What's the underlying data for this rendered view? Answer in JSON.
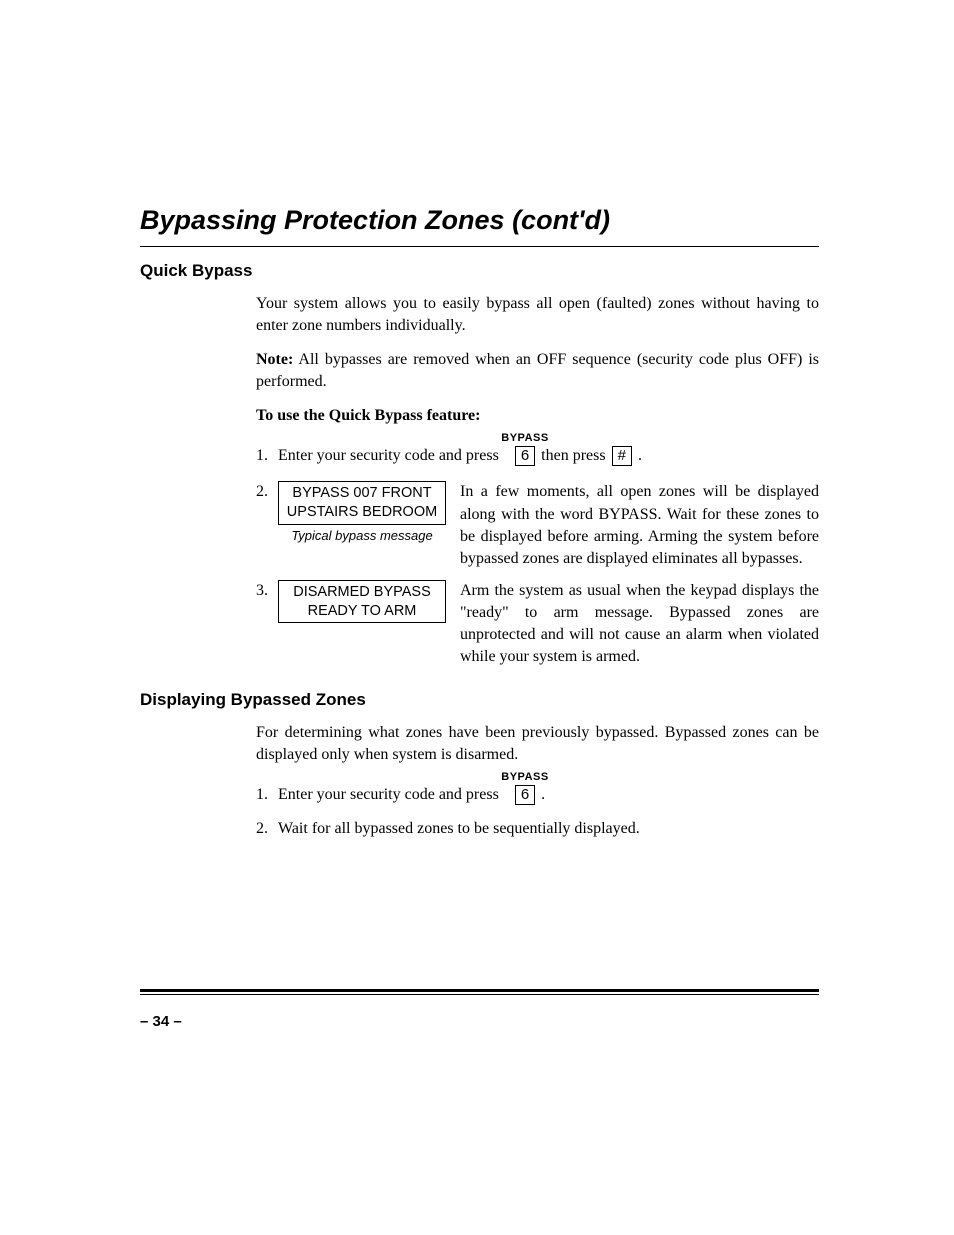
{
  "title": "Bypassing Protection Zones (cont'd)",
  "section1": {
    "heading": "Quick Bypass",
    "p1": "Your system allows you to easily bypass all open (faulted) zones without having to enter zone numbers individually.",
    "note_label": "Note:",
    "note_text": " All bypasses are removed when an OFF sequence (security code plus OFF) is performed.",
    "use_heading": "To use the Quick Bypass feature:",
    "step1": {
      "num": "1.",
      "text_a": "Enter your security code and press",
      "key1_label": "BYPASS",
      "key1": "6",
      "text_b": "then press",
      "key2": "#",
      "text_c": "."
    },
    "step2": {
      "num": "2.",
      "display_line1": "BYPASS  007 FRONT",
      "display_line2": "UPSTAIRS BEDROOM",
      "caption": "Typical bypass message",
      "text": "In a few moments, all open zones will be displayed along with the word BYPASS. Wait for these zones to be displayed before arming. Arming the system before bypassed zones are displayed eliminates all bypasses."
    },
    "step3": {
      "num": "3.",
      "display_line1": "DISARMED BYPASS",
      "display_line2": "READY TO ARM",
      "text": "Arm the system as usual when the keypad displays the \"ready\" to arm message. Bypassed zones are unprotected and will not cause an alarm when violated while your system is armed."
    }
  },
  "section2": {
    "heading": "Displaying Bypassed Zones",
    "p1": "For determining what zones have been previously bypassed. Bypassed zones can be displayed only when system is disarmed.",
    "step1": {
      "num": "1.",
      "text_a": "Enter your security code and press",
      "key1_label": "BYPASS",
      "key1": "6",
      "text_c": "."
    },
    "step2": {
      "num": "2.",
      "text": "Wait for all bypassed zones to be sequentially displayed."
    }
  },
  "page_number": "– 34 –"
}
